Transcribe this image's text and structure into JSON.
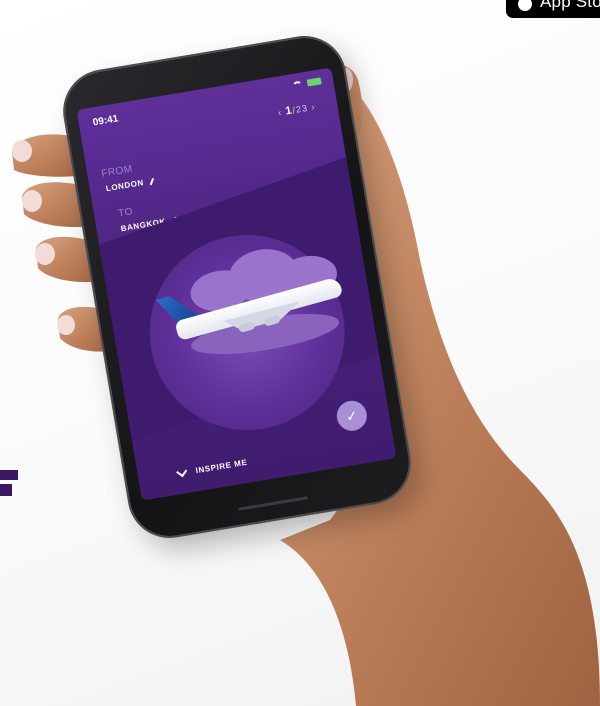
{
  "app_store_badge": {
    "label": "App Store"
  },
  "phone": {
    "status_time": "09:41",
    "pager": {
      "current": "1",
      "total": "/23"
    },
    "from": {
      "label": "FROM",
      "value": "LONDON"
    },
    "to": {
      "label": "TO",
      "value": "BANGKOK"
    },
    "inspire_label": "INSPIRE ME",
    "confirm_glyph": "✓"
  },
  "colors": {
    "screen_purple": "#4b237f",
    "brand_dark": "#3a1760",
    "confirm": "#a98fd6"
  }
}
